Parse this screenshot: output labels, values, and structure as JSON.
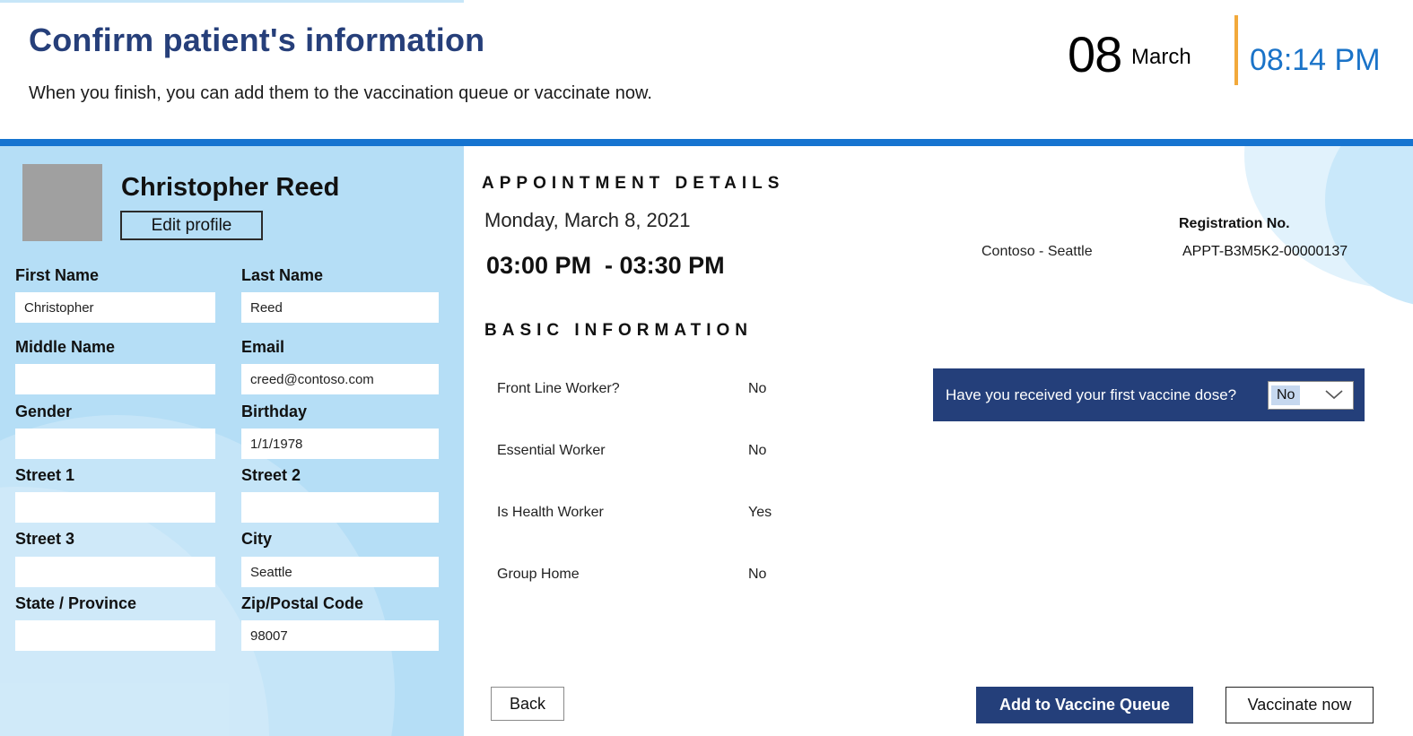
{
  "header": {
    "title": "Confirm patient's information",
    "subtitle": "When you finish, you can add them to the vaccination queue or vaccinate now.",
    "date_day": "08",
    "date_month": "March",
    "time": "08:14 PM"
  },
  "profile": {
    "name": "Christopher Reed",
    "edit_label": "Edit profile",
    "fields": {
      "first_name": {
        "label": "First Name",
        "value": "Christopher"
      },
      "last_name": {
        "label": "Last Name",
        "value": "Reed"
      },
      "middle_name": {
        "label": "Middle Name",
        "value": ""
      },
      "email": {
        "label": "Email",
        "value": "creed@contoso.com"
      },
      "gender": {
        "label": "Gender",
        "value": ""
      },
      "birthday": {
        "label": "Birthday",
        "value": "1/1/1978"
      },
      "street1": {
        "label": "Street 1",
        "value": ""
      },
      "street2": {
        "label": "Street 2",
        "value": ""
      },
      "street3": {
        "label": "Street 3",
        "value": ""
      },
      "city": {
        "label": "City",
        "value": "Seattle"
      },
      "state": {
        "label": "State / Province",
        "value": ""
      },
      "zip": {
        "label": "Zip/Postal Code",
        "value": "98007"
      }
    }
  },
  "appointment": {
    "heading": "APPOINTMENT DETAILS",
    "date": "Monday, March 8, 2021",
    "time_range": "03:00 PM  - 03:30 PM",
    "location": "Contoso - Seattle",
    "registration_label": "Registration No.",
    "registration_value": "APPT-B3M5K2-00000137"
  },
  "basic_info": {
    "heading": "BASIC INFORMATION",
    "items": [
      {
        "label": "Front Line Worker?",
        "value": "No"
      },
      {
        "label": "Essential Worker",
        "value": "No"
      },
      {
        "label": "Is Health Worker",
        "value": "Yes"
      },
      {
        "label": "Group Home",
        "value": "No"
      }
    ]
  },
  "vaccine_question": {
    "question": "Have you received your first vaccine dose?",
    "selected": "No"
  },
  "actions": {
    "back": "Back",
    "add_to_queue": "Add to Vaccine Queue",
    "vaccinate_now": "Vaccinate now"
  },
  "colors": {
    "title": "#263f7a",
    "accent_blue": "#1674d0",
    "time": "#1a73c8",
    "divider": "#f2a93b",
    "panel": "#b5def6",
    "navy_button": "#243f7a"
  }
}
